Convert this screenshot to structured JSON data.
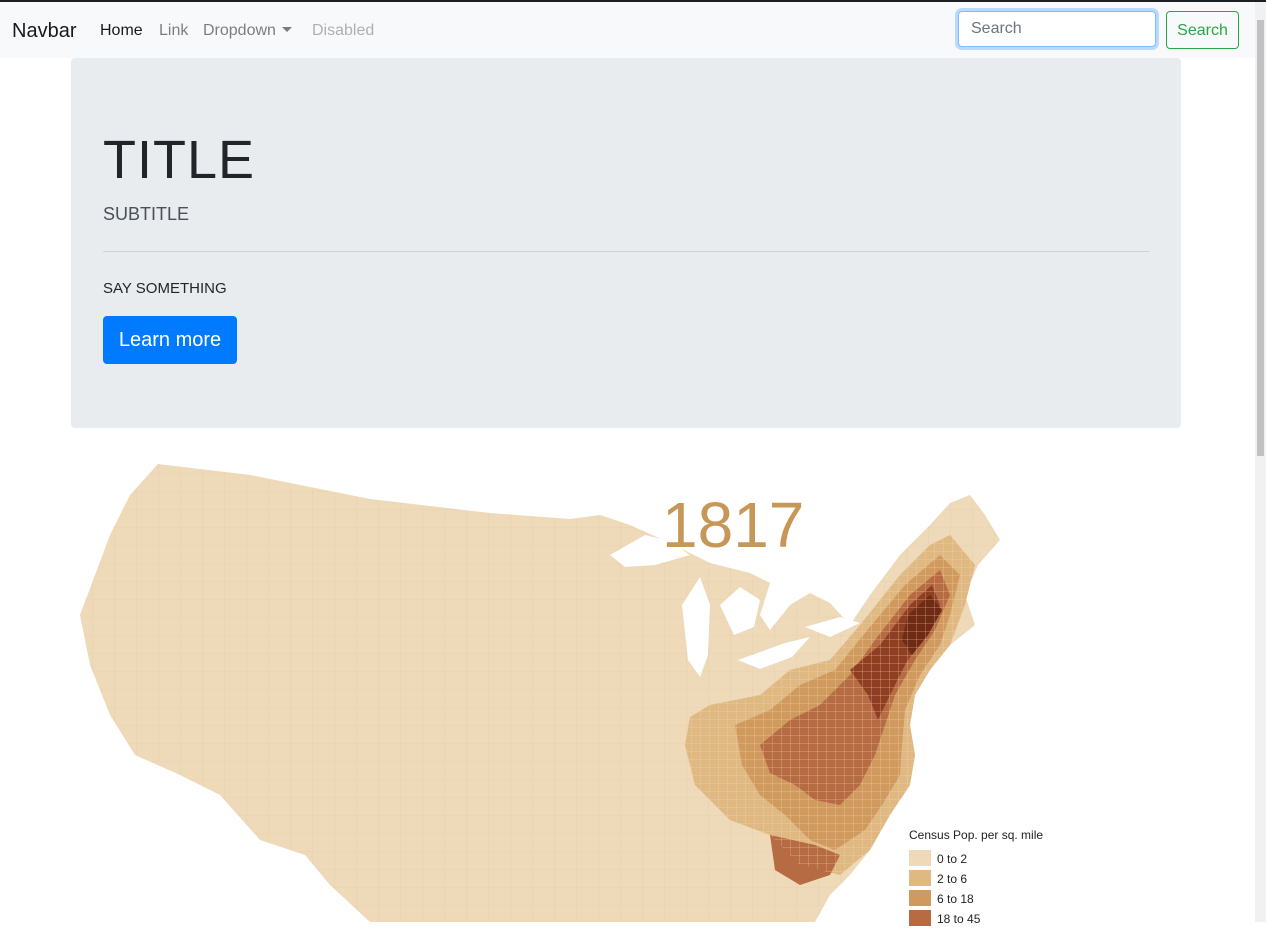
{
  "navbar": {
    "brand": "Navbar",
    "links": [
      {
        "label": "Home",
        "state": "active"
      },
      {
        "label": "Link",
        "state": "normal"
      },
      {
        "label": "Dropdown",
        "state": "dropdown"
      },
      {
        "label": "Disabled",
        "state": "disabled"
      }
    ],
    "search_placeholder": "Search",
    "search_button": "Search"
  },
  "jumbotron": {
    "title": "TITLE",
    "subtitle": "SUBTITLE",
    "text": "SAY SOMETHING",
    "button": "Learn more"
  },
  "map": {
    "year": "1817",
    "legend_title": "Census Pop. per sq. mile",
    "legend": [
      {
        "label": "0 to 2",
        "color": "#eed9b9"
      },
      {
        "label": "2 to 6",
        "color": "#e0b882"
      },
      {
        "label": "6 to 18",
        "color": "#d09a5e"
      },
      {
        "label": "18 to 45",
        "color": "#b66b43"
      }
    ]
  },
  "colors": {
    "primary": "#007bff",
    "success": "#28a745",
    "jumbotron_bg": "#e9ecef",
    "navbar_bg": "#f8f9fa",
    "year_text": "#c79758"
  }
}
